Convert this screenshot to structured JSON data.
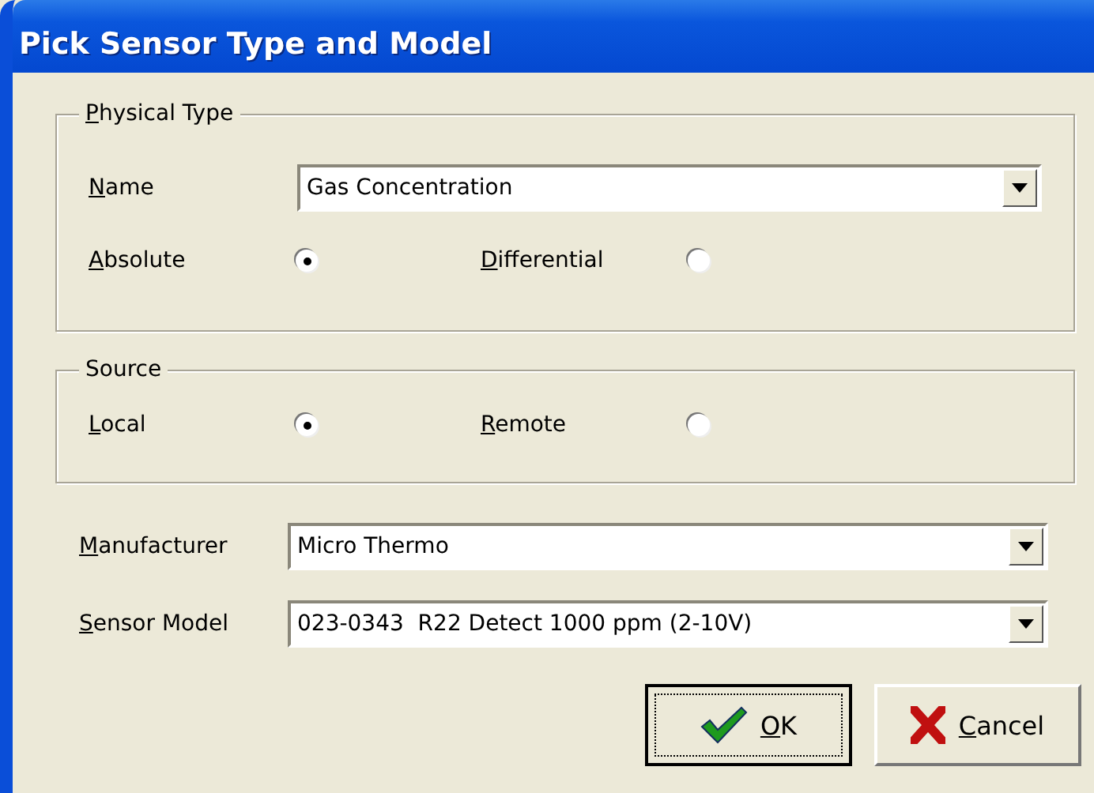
{
  "window": {
    "title": "Pick Sensor Type and Model"
  },
  "physical_type": {
    "legend": "Physical Type",
    "legend_underline_first": true,
    "name": {
      "label": "Name",
      "underline_first": true,
      "value": "Gas Concentration"
    },
    "options": [
      {
        "label": "Absolute",
        "underline_first": true,
        "selected": true
      },
      {
        "label": "Differential",
        "underline_first": true,
        "selected": false
      }
    ]
  },
  "source": {
    "legend": "Source",
    "legend_underline_first": false,
    "options": [
      {
        "label": "Local",
        "underline_first": true,
        "selected": true
      },
      {
        "label": "Remote",
        "underline_first": true,
        "selected": false
      }
    ]
  },
  "fields": [
    {
      "label": "Manufacturer",
      "underline_first": true,
      "value": "Micro Thermo"
    },
    {
      "label": "Sensor Model",
      "underline_first": true,
      "value": "023-0343  R22 Detect 1000 ppm (2-10V)"
    }
  ],
  "buttons": [
    {
      "label": "OK",
      "kind": "ok",
      "default": true
    },
    {
      "label": "Cancel",
      "kind": "cancel",
      "default": false
    }
  ]
}
